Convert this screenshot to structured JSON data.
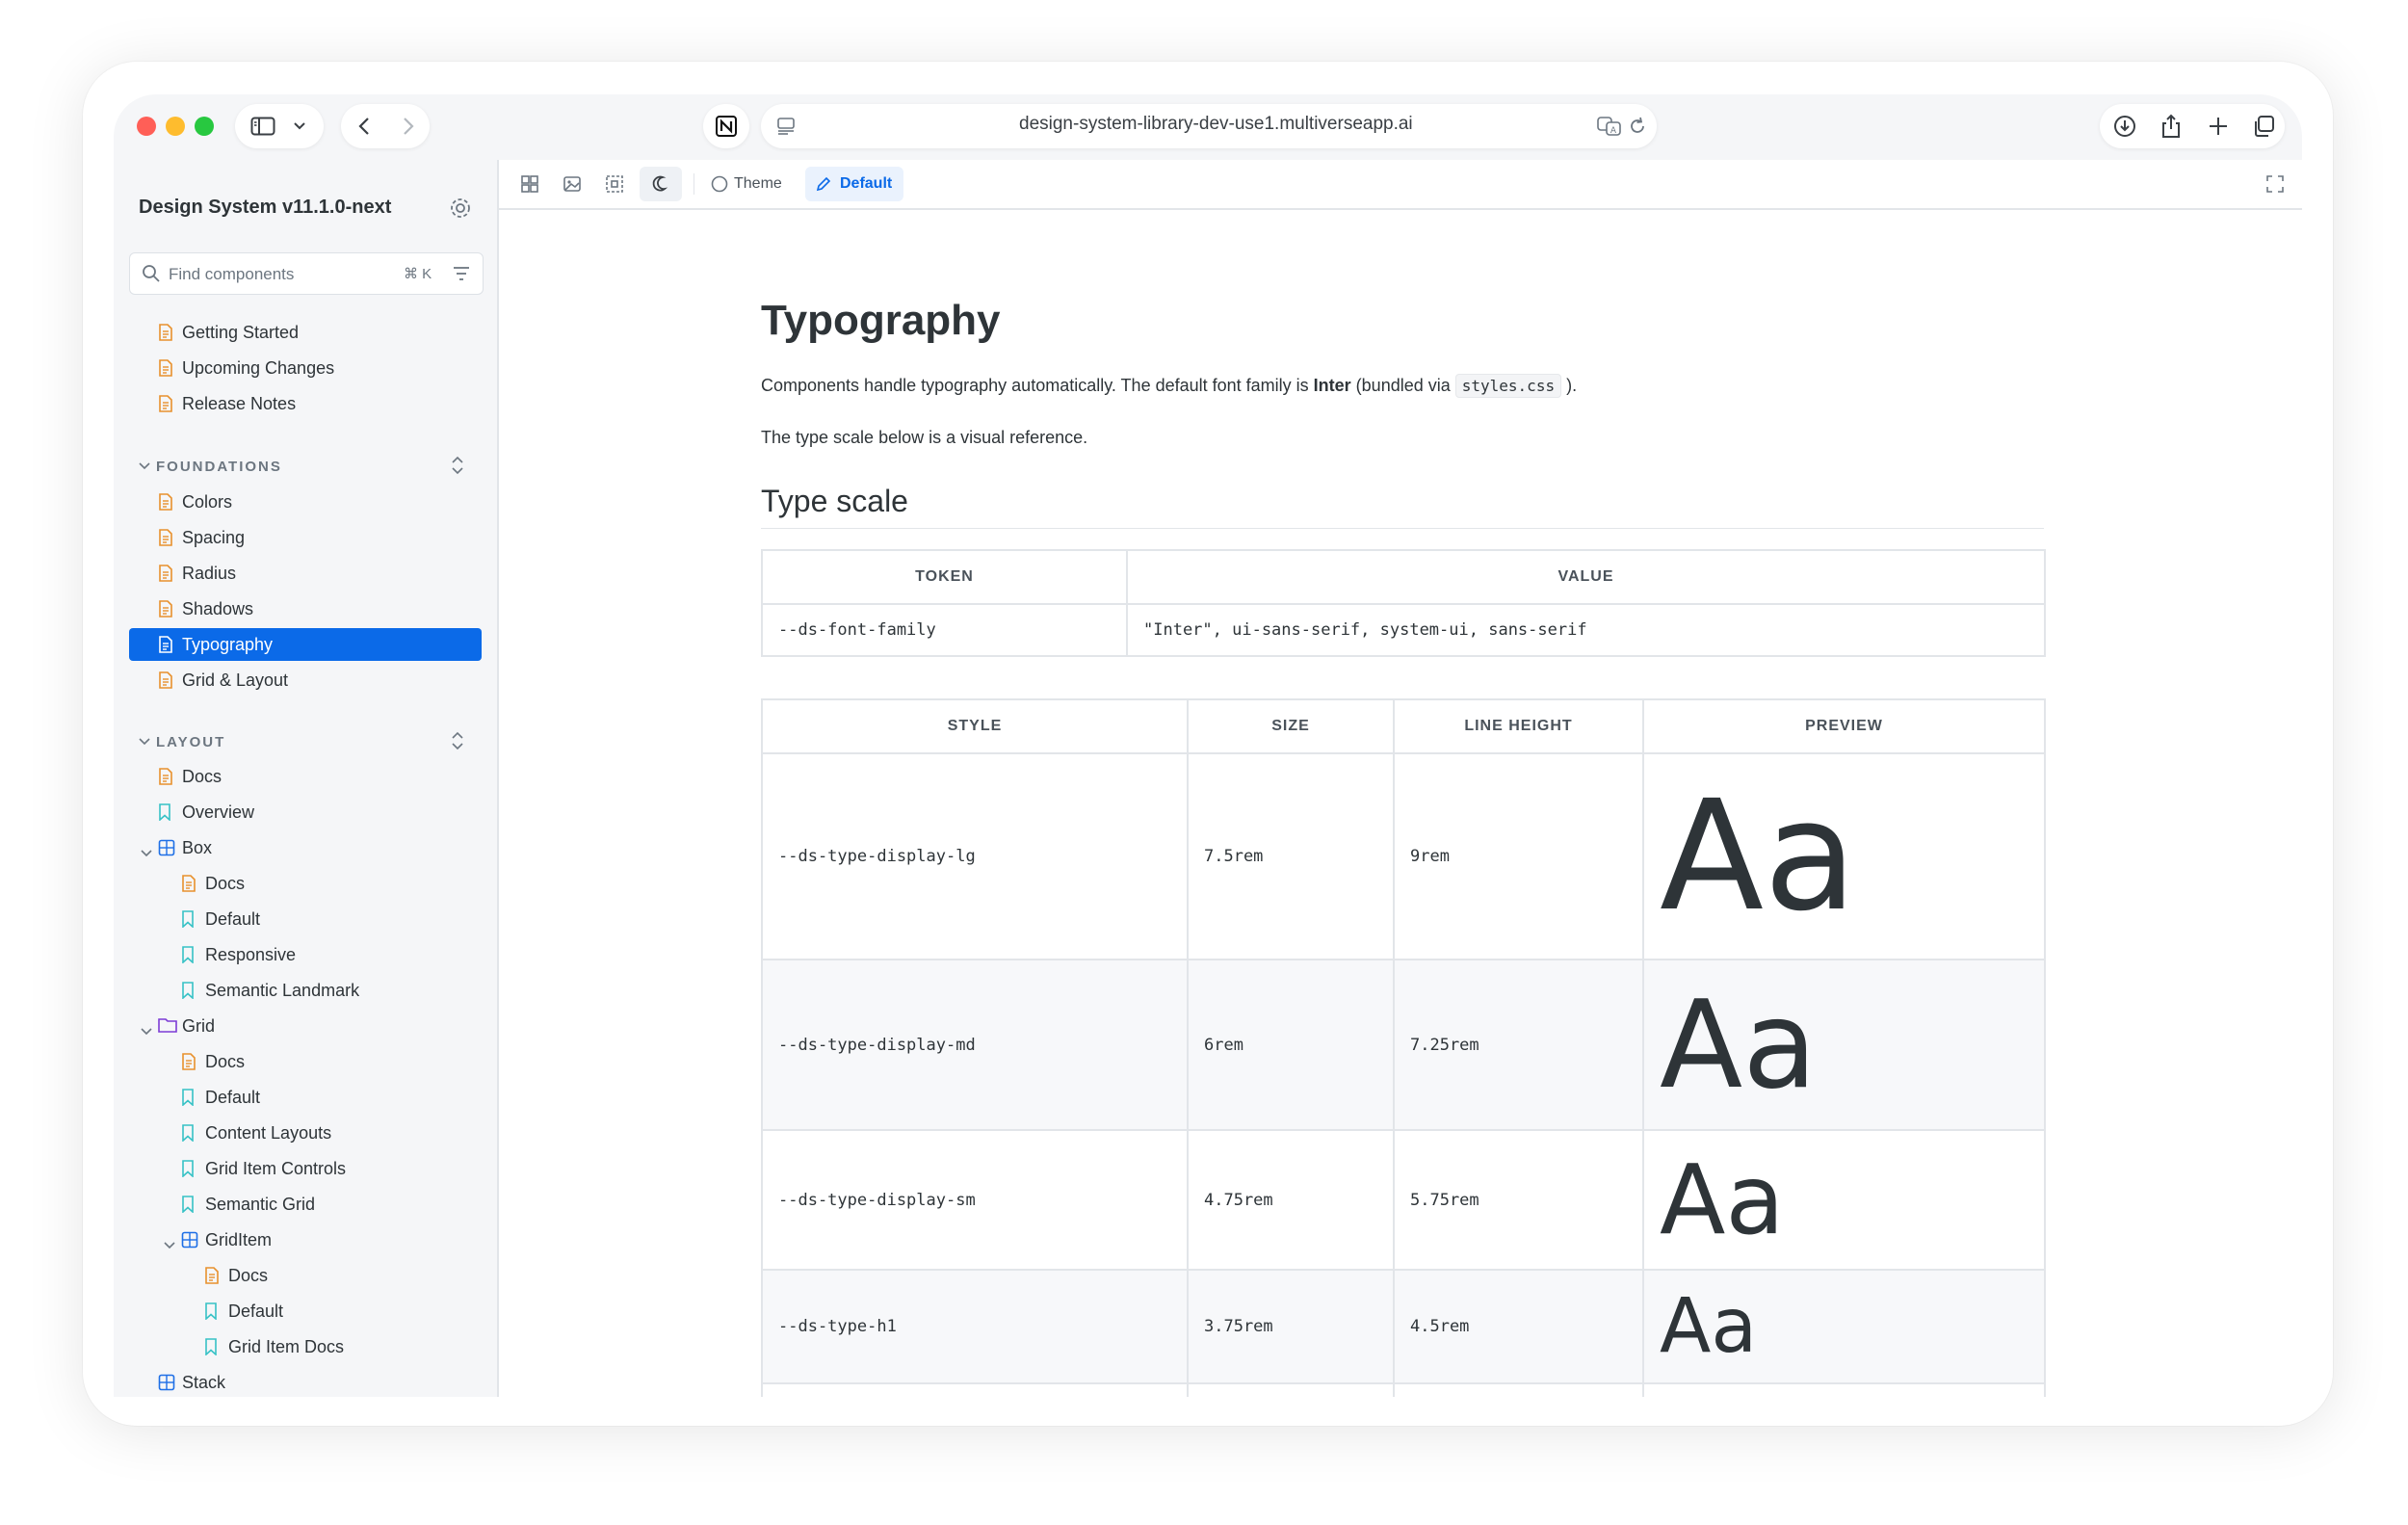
{
  "browser": {
    "url": "design-system-library-dev-use1.multiverseapp.ai",
    "traffic_lights": {
      "close": "#ff5f57",
      "minimize": "#febc2e",
      "maximize": "#28c840"
    }
  },
  "sidebar": {
    "title": "Design System v11.1.0-next",
    "search_placeholder": "Find components",
    "search_shortcut": "⌘ K",
    "top_items": [
      {
        "label": "Getting Started",
        "icon": "document-icon"
      },
      {
        "label": "Upcoming Changes",
        "icon": "document-icon"
      },
      {
        "label": "Release Notes",
        "icon": "document-icon"
      }
    ],
    "foundations": {
      "heading": "FOUNDATIONS",
      "items": [
        {
          "label": "Colors",
          "icon": "document-icon"
        },
        {
          "label": "Spacing",
          "icon": "document-icon"
        },
        {
          "label": "Radius",
          "icon": "document-icon"
        },
        {
          "label": "Shadows",
          "icon": "document-icon"
        },
        {
          "label": "Typography",
          "icon": "document-icon",
          "selected": true
        },
        {
          "label": "Grid & Layout",
          "icon": "document-icon"
        }
      ]
    },
    "layout": {
      "heading": "LAYOUT",
      "items": [
        {
          "label": "Docs",
          "icon": "document-icon"
        },
        {
          "label": "Overview",
          "icon": "bookmark-icon"
        },
        {
          "label": "Box",
          "icon": "component-icon"
        },
        {
          "label": "Docs",
          "icon": "document-icon"
        },
        {
          "label": "Default",
          "icon": "bookmark-icon"
        },
        {
          "label": "Responsive",
          "icon": "bookmark-icon"
        },
        {
          "label": "Semantic Landmark",
          "icon": "bookmark-icon"
        },
        {
          "label": "Grid",
          "icon": "folder-icon"
        },
        {
          "label": "Docs",
          "icon": "document-icon"
        },
        {
          "label": "Default",
          "icon": "bookmark-icon"
        },
        {
          "label": "Content Layouts",
          "icon": "bookmark-icon"
        },
        {
          "label": "Grid Item Controls",
          "icon": "bookmark-icon"
        },
        {
          "label": "Semantic Grid",
          "icon": "bookmark-icon"
        },
        {
          "label": "GridItem",
          "icon": "component-icon"
        },
        {
          "label": "Docs",
          "icon": "document-icon"
        },
        {
          "label": "Default",
          "icon": "bookmark-icon"
        },
        {
          "label": "Grid Item Docs",
          "icon": "bookmark-icon"
        },
        {
          "label": "Stack",
          "icon": "component-icon"
        }
      ]
    }
  },
  "toolbar": {
    "theme_label": "Theme",
    "default_label": "Default",
    "accent": "#0b6ae8"
  },
  "content": {
    "title": "Typography",
    "intro_before": "Components handle typography automatically. The default font family is ",
    "intro_bold": "Inter",
    "intro_middle": " (bundled via ",
    "intro_code": "styles.css",
    "intro_after": " ).",
    "note": "The type scale below is a visual reference.",
    "section_title": "Type scale",
    "token_table": {
      "headers": [
        "TOKEN",
        "VALUE"
      ],
      "rows": [
        [
          "--ds-font-family",
          "\"Inter\", ui-sans-serif, system-ui, sans-serif"
        ]
      ]
    },
    "scale_table": {
      "headers": [
        "STYLE",
        "SIZE",
        "LINE HEIGHT",
        "PREVIEW"
      ],
      "rows": [
        {
          "style": "--ds-type-display-lg",
          "size": "7.5rem",
          "line_height": "9rem",
          "preview": "Aa"
        },
        {
          "style": "--ds-type-display-md",
          "size": "6rem",
          "line_height": "7.25rem",
          "preview": "Aa"
        },
        {
          "style": "--ds-type-display-sm",
          "size": "4.75rem",
          "line_height": "5.75rem",
          "preview": "Aa"
        },
        {
          "style": "--ds-type-h1",
          "size": "3.75rem",
          "line_height": "4.5rem",
          "preview": "Aa"
        }
      ]
    },
    "tooltip": "storybook-preview-iframe"
  }
}
